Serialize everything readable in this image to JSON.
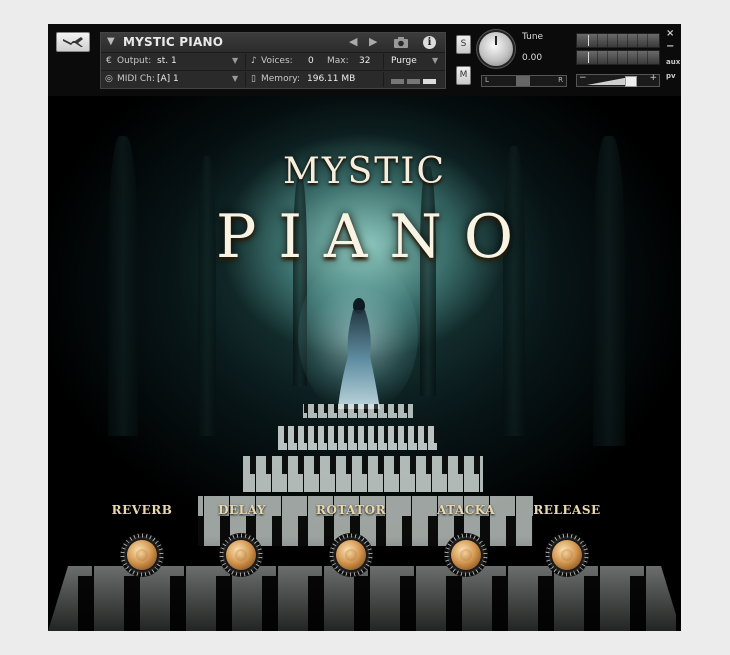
{
  "header": {
    "instrument_name": "MYSTIC PIANO",
    "output_label": "Output:",
    "output_value": "st. 1",
    "voices_label": "Voices:",
    "voices_value": "0",
    "max_label": "Max:",
    "max_value": "32",
    "purge_label": "Purge",
    "midi_label": "MIDI Ch:",
    "midi_value": "[A]  1",
    "memory_label": "Memory:",
    "memory_value": "196.11 MB",
    "solo_label": "S",
    "mute_label": "M",
    "tune_label": "Tune",
    "tune_value": "0.00",
    "pan_left": "L",
    "pan_right": "R",
    "vol_minus": "−",
    "vol_plus": "+",
    "close_glyph": "×",
    "min_glyph": "−",
    "aux_label": "aux",
    "pv_label": "pv",
    "info_glyph": "i"
  },
  "artwork": {
    "title_line1": "MYSTIC",
    "title_line2": "PIANO"
  },
  "controls": [
    {
      "label": "REVERB"
    },
    {
      "label": "DELAY"
    },
    {
      "label": "ROTATOR"
    },
    {
      "label": "ATACKA"
    },
    {
      "label": "RELEASE"
    }
  ],
  "colors": {
    "label_gold": "#e9d7ad",
    "knob_copper": "#d59a52",
    "header_bg": "#2a2a2a"
  }
}
